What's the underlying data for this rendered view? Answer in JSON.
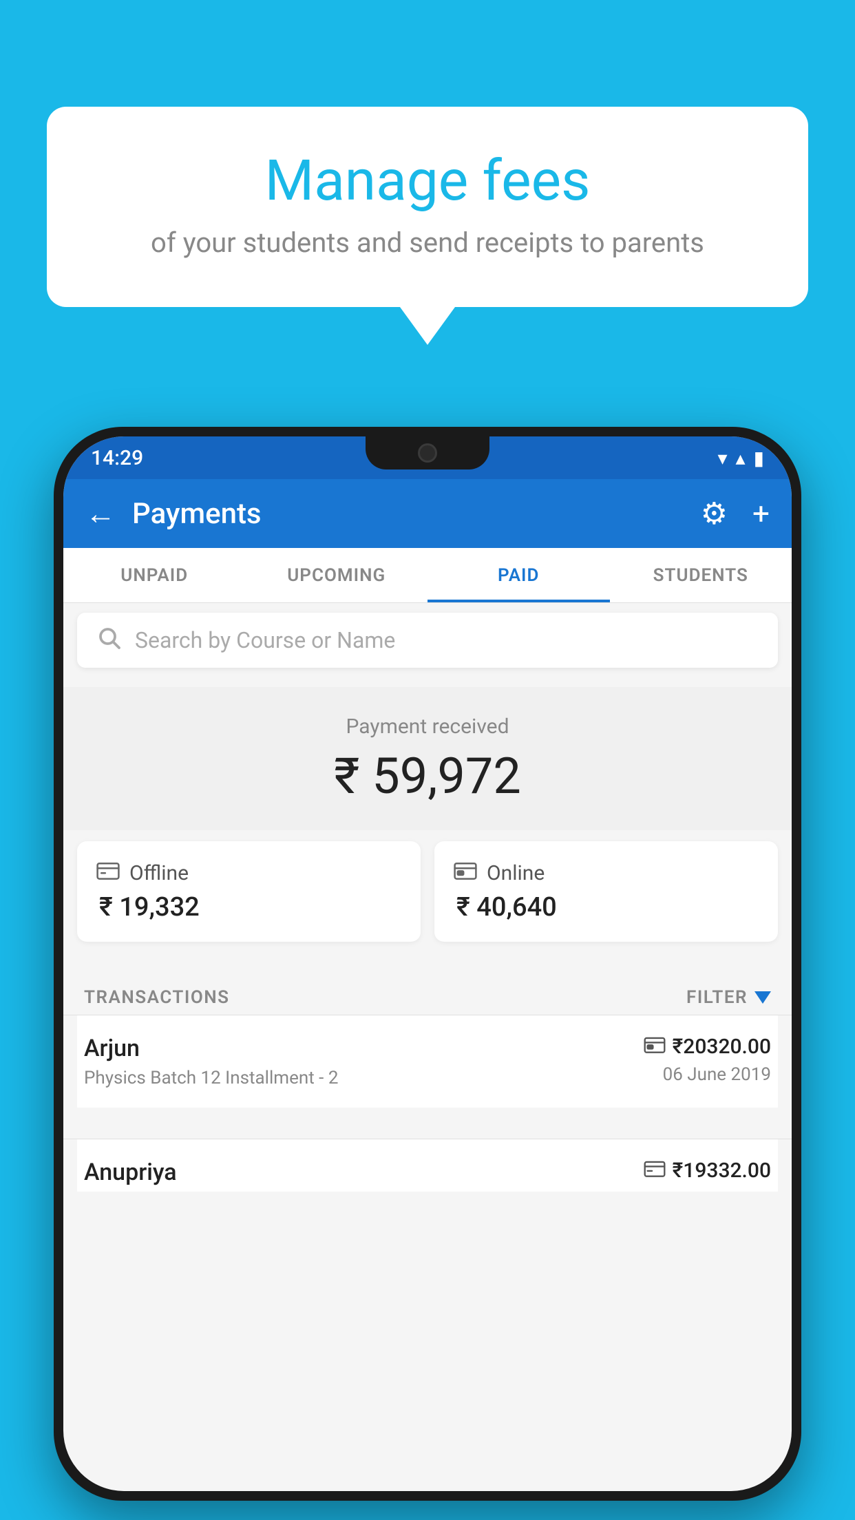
{
  "background_color": "#1ab8e8",
  "speech_bubble": {
    "title": "Manage fees",
    "subtitle": "of your students and send receipts to parents"
  },
  "status_bar": {
    "time": "14:29",
    "wifi": "▼",
    "signal": "▲",
    "battery": "▌"
  },
  "app_bar": {
    "title": "Payments",
    "back_icon": "←",
    "settings_icon": "⚙",
    "add_icon": "+"
  },
  "tabs": [
    {
      "label": "UNPAID",
      "active": false
    },
    {
      "label": "UPCOMING",
      "active": false
    },
    {
      "label": "PAID",
      "active": true
    },
    {
      "label": "STUDENTS",
      "active": false
    }
  ],
  "search": {
    "placeholder": "Search by Course or Name"
  },
  "payment_received": {
    "label": "Payment received",
    "amount": "₹ 59,972"
  },
  "cards": [
    {
      "type": "Offline",
      "amount": "₹ 19,332",
      "icon": "💵"
    },
    {
      "type": "Online",
      "amount": "₹ 40,640",
      "icon": "💳"
    }
  ],
  "transactions_label": "TRANSACTIONS",
  "filter_label": "FILTER",
  "transactions": [
    {
      "name": "Arjun",
      "detail": "Physics Batch 12 Installment - 2",
      "amount": "₹20320.00",
      "date": "06 June 2019",
      "mode": "online"
    },
    {
      "name": "Anupriya",
      "detail": "",
      "amount": "₹19332.00",
      "date": "",
      "mode": "offline"
    }
  ]
}
